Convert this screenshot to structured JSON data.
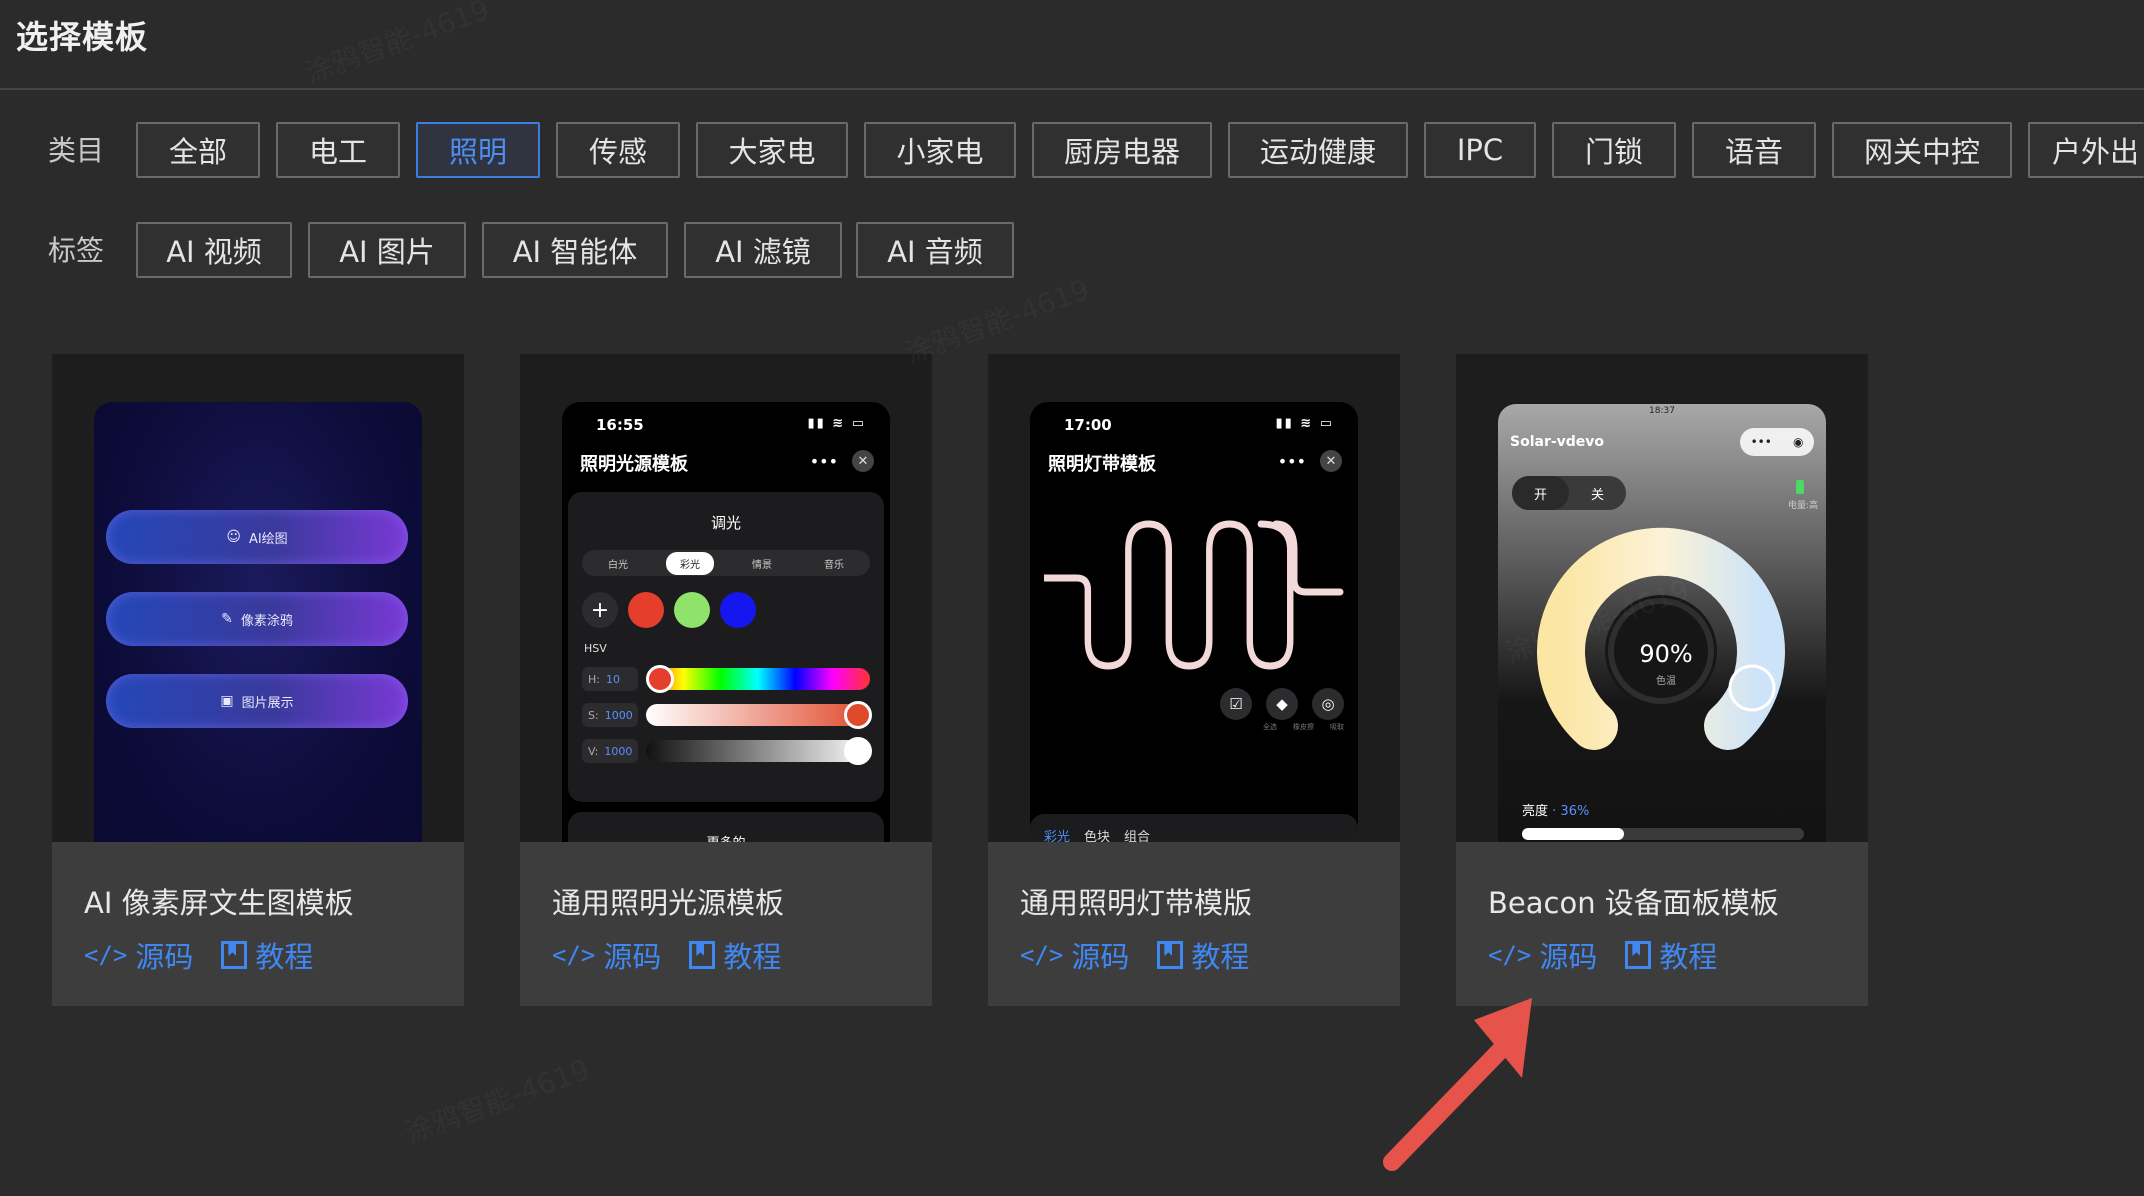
{
  "header": {
    "title": "选择模板"
  },
  "filters": {
    "category_label": "类目",
    "categories": [
      {
        "label": "全部",
        "active": false
      },
      {
        "label": "电工",
        "active": false
      },
      {
        "label": "照明",
        "active": true
      },
      {
        "label": "传感",
        "active": false
      },
      {
        "label": "大家电",
        "active": false
      },
      {
        "label": "小家电",
        "active": false
      },
      {
        "label": "厨房电器",
        "active": false
      },
      {
        "label": "运动健康",
        "active": false
      },
      {
        "label": "IPC",
        "active": false
      },
      {
        "label": "门锁",
        "active": false
      },
      {
        "label": "语音",
        "active": false
      },
      {
        "label": "网关中控",
        "active": false
      },
      {
        "label": "户外出",
        "active": false
      }
    ],
    "tag_label": "标签",
    "tags": [
      {
        "label": "AI 视频"
      },
      {
        "label": "AI 图片"
      },
      {
        "label": "AI 智能体"
      },
      {
        "label": "AI 滤镜"
      },
      {
        "label": "AI 音频"
      }
    ]
  },
  "cards": [
    {
      "name": "AI 像素屏文生图模板",
      "source_label": "源码",
      "tutorial_label": "教程",
      "preview": {
        "buttons": [
          "AI绘图",
          "像素涂鸦",
          "图片展示"
        ]
      }
    },
    {
      "name": "通用照明光源模板",
      "source_label": "源码",
      "tutorial_label": "教程",
      "preview": {
        "time": "16:55",
        "title": "照明光源模板",
        "panel_title": "调光",
        "modes": [
          "白光",
          "彩光",
          "情景",
          "音乐"
        ],
        "active_mode": "彩光",
        "hsv_label": "HSV",
        "h": {
          "key": "H:",
          "value": "10"
        },
        "s": {
          "key": "S:",
          "value": "1000"
        },
        "v": {
          "key": "V:",
          "value": "1000"
        },
        "more": "更多的"
      }
    },
    {
      "name": "通用照明灯带模版",
      "source_label": "源码",
      "tutorial_label": "教程",
      "preview": {
        "time": "17:00",
        "title": "照明灯带模板",
        "tool_labels": [
          "全选",
          "橡皮擦",
          "吸取"
        ],
        "tabs": [
          "彩光",
          "色块",
          "组合"
        ]
      }
    },
    {
      "name": "Beacon 设备面板模板",
      "source_label": "源码",
      "tutorial_label": "教程",
      "preview": {
        "time": "18:37",
        "device": "Solar-vdevo",
        "on_label": "开",
        "off_label": "关",
        "battery_label": "电量:高",
        "dial_value": "90%",
        "dial_caption": "色温",
        "brightness_label": "亮度",
        "brightness_value": "36%",
        "brightness": 0.36
      }
    }
  ],
  "colors": {
    "accent": "#3f88f2",
    "annotation_arrow": "#e5534b"
  },
  "watermark": "涂鸦智能-4619"
}
